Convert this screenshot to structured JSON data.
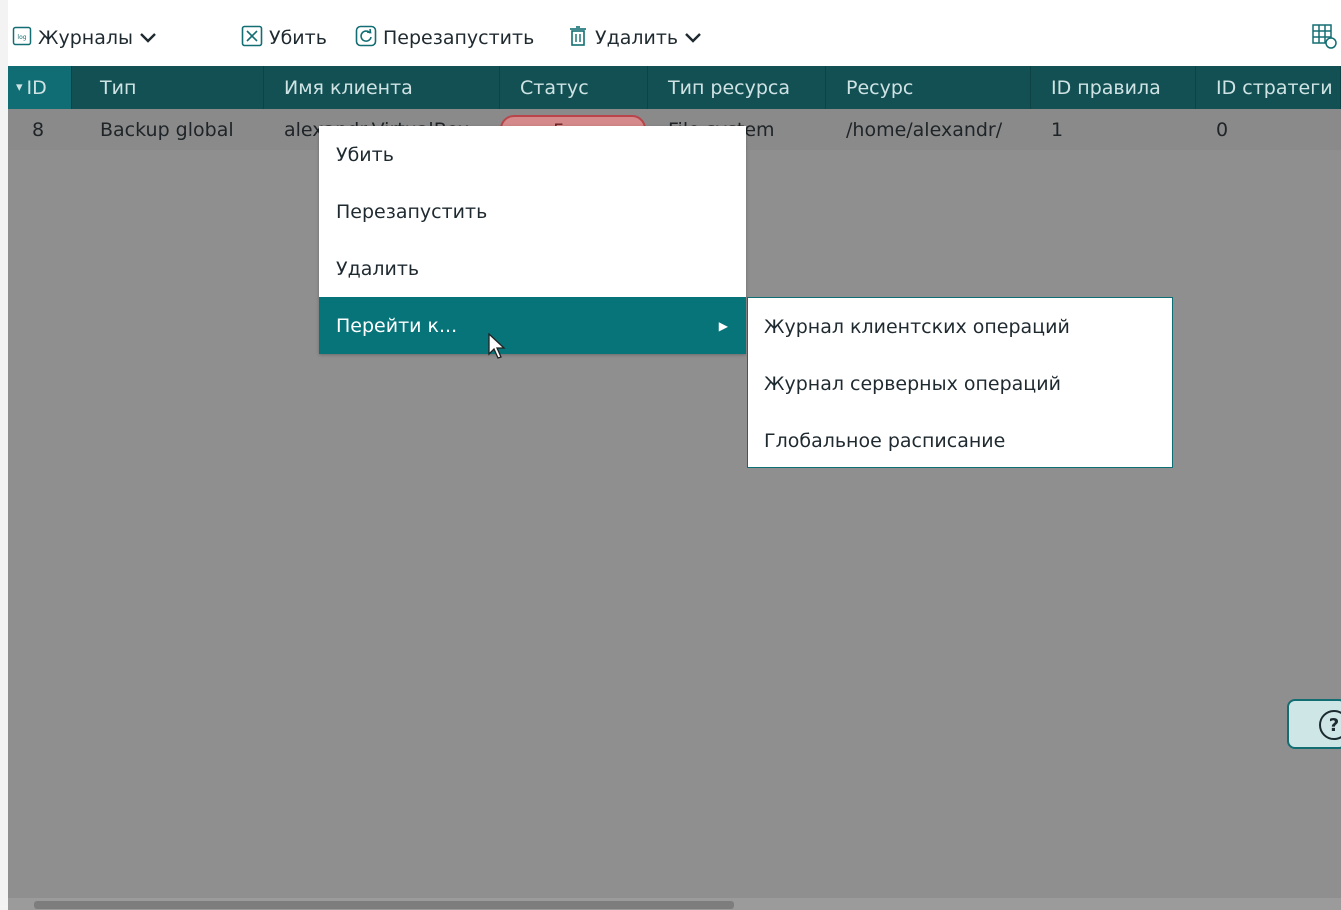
{
  "toolbar": {
    "journals_label": "Журналы",
    "kill_label": "Убить",
    "restart_label": "Перезапустить",
    "delete_label": "Удалить",
    "journals_icon": "log-icon",
    "kill_icon": "close-square-icon",
    "restart_icon": "refresh-icon",
    "delete_icon": "trash-icon",
    "grid_settings_icon": "table-settings-icon"
  },
  "table": {
    "columns": [
      "ID",
      "Тип",
      "Имя клиента",
      "Статус",
      "Тип ресурса",
      "Ресурс",
      "ID правила",
      "ID стратеги"
    ],
    "sort_indicator": "▾",
    "rows": [
      {
        "id": "8",
        "type": "Backup global",
        "client": "alexandr-VirtualBox",
        "status": "Error",
        "resource_type": "File system",
        "resource": "/home/alexandr/",
        "rule_id": "1",
        "strategy_id": "0"
      }
    ]
  },
  "context_menu": {
    "items": [
      "Убить",
      "Перезапустить",
      "Удалить",
      "Перейти к..."
    ],
    "active_index": 3,
    "submenu": [
      "Журнал клиентских операций",
      "Журнал серверных операций",
      "Глобальное расписание"
    ]
  },
  "help": {
    "label": "?"
  },
  "colors": {
    "header_bg": "#135054",
    "accent": "#07747a",
    "error_border": "#b9454a"
  }
}
